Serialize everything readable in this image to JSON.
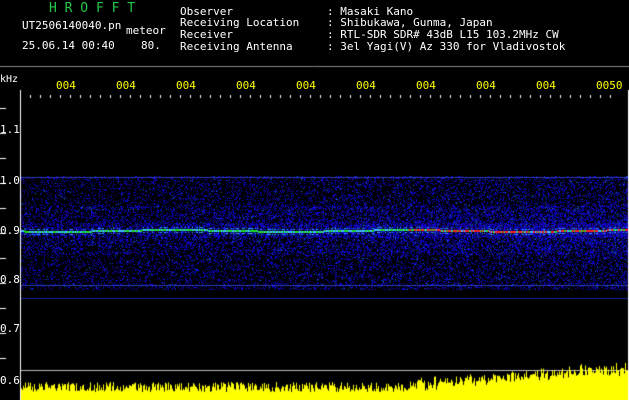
{
  "header": {
    "brand": "H R O F F T",
    "file_name": "UT2506140040.pn",
    "mode": "meteor",
    "datetime": "25.06.14 00:40",
    "rate": "80.",
    "info": [
      {
        "label": "Observer",
        "value": ": Masaki Kano"
      },
      {
        "label": "Receiving Location",
        "value": ": Shibukawa, Gunma, Japan"
      },
      {
        "label": "Receiver",
        "value": ": RTL-SDR SDR# 43dB L15 103.2MHz CW"
      },
      {
        "label": "Receiving Antenna",
        "value": ": 3el Yagi(V) Az 330 for Vladivostok"
      }
    ]
  },
  "plot": {
    "y_unit": "kHz",
    "time_ticks": [
      "004",
      "004",
      "004",
      "004",
      "004",
      "004",
      "004",
      "004",
      "004",
      "0050"
    ],
    "y_labels": [
      "1.1",
      "1.0",
      "0.9",
      "0.8",
      "0.7",
      "0.6"
    ],
    "colors": {
      "tick_text": "#ffff00",
      "trace": "#ff2020",
      "noise": "#1030d0",
      "histogram": "#ffff00"
    }
  }
}
